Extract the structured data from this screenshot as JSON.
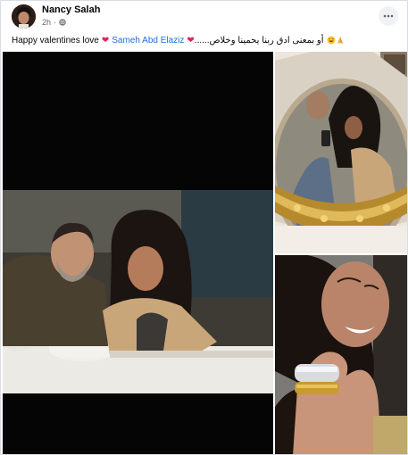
{
  "post": {
    "author_name": "Nancy Salah",
    "timestamp": "2h",
    "privacy_icon": "globe-icon",
    "more_icon": "more-options-icon",
    "caption": {
      "text_before_tag": "Happy valentines love",
      "tag": "Sameh Abd Elaziz",
      "arabic_text": "أو بمعنى ادق ربنا يحمينا وخلاص......",
      "heart_emoji": "❤",
      "laugh_emoji": "😂",
      "pray_emoji": "🙏"
    }
  },
  "colors": {
    "tag_link": "#216fdb",
    "heart": "#e0245e",
    "muted_text": "#65676b"
  }
}
